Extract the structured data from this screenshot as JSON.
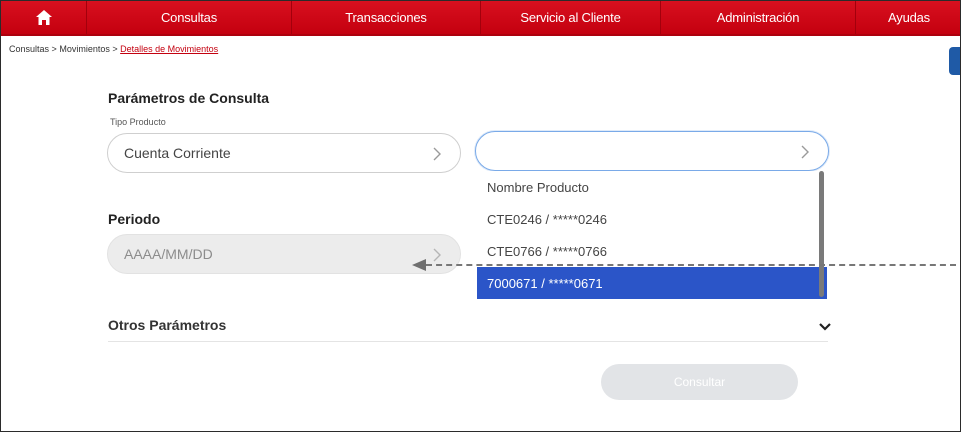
{
  "nav": {
    "items": [
      "Consultas",
      "Transacciones",
      "Servicio al Cliente",
      "Administración",
      "Ayudas"
    ]
  },
  "breadcrumb": {
    "part1": "Consultas",
    "sep1": ">",
    "part2": "Movimientos",
    "sep2": ">",
    "current": "Detalles de Movimientos"
  },
  "params": {
    "title": "Parámetros de Consulta",
    "tipo_label": "Tipo Producto",
    "tipo_value": "Cuenta Corriente",
    "producto_value": ""
  },
  "dropdown": {
    "options": [
      "Nombre Producto",
      "CTE0246 / *****0246",
      "CTE0766 / *****0766",
      "7000671 / *****0671"
    ],
    "selected_index": 3
  },
  "periodo": {
    "title": "Periodo",
    "placeholder": "AAAA/MM/DD"
  },
  "otros": {
    "title": "Otros Parámetros"
  },
  "actions": {
    "consultar_label": "Consultar"
  },
  "colors": {
    "nav_red": "#d0021b",
    "selected_blue": "#2b55c8",
    "focus_blue": "#7aaae8"
  }
}
